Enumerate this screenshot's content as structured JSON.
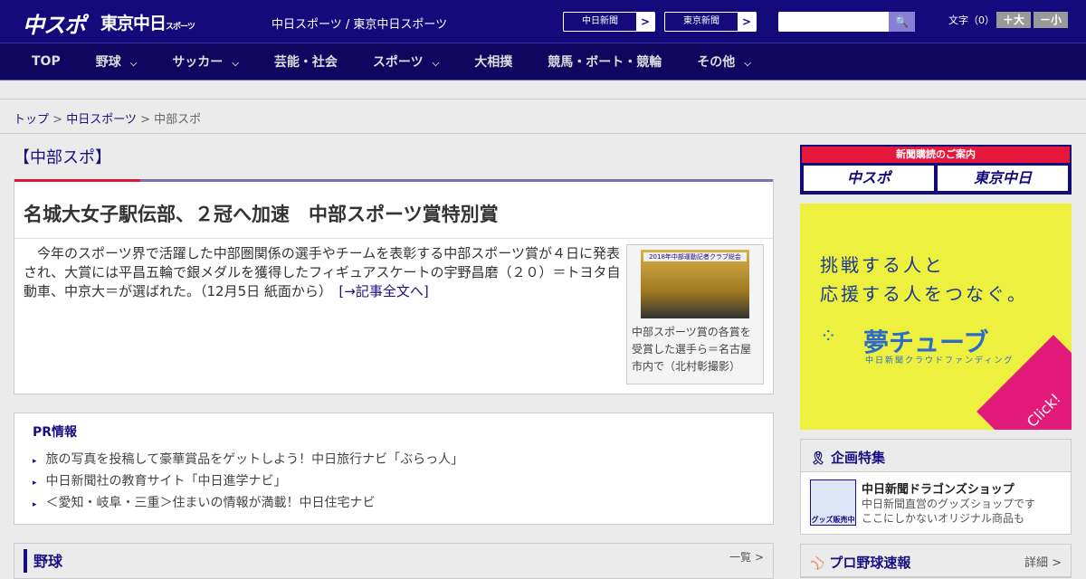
{
  "header": {
    "logo_chuspo": "中スポ",
    "logo_tokyo": "東京中日",
    "logo_tokyo_small": "スポーツ",
    "tagline": "中日スポーツ / 東京中日スポーツ",
    "links": [
      {
        "label": "中日新聞",
        "arrow": ">"
      },
      {
        "label": "東京新聞",
        "arrow": ">"
      }
    ],
    "search": {
      "placeholder": "",
      "icon": "search-icon",
      "glyph": "🔍"
    },
    "font_size_label": "文字（0）",
    "font_larger": "＋大",
    "font_smaller": "－小"
  },
  "nav": [
    {
      "label": "TOP"
    },
    {
      "label": "野球",
      "chev": "⌵"
    },
    {
      "label": "サッカー",
      "chev": "⌵"
    },
    {
      "label": "芸能・社会"
    },
    {
      "label": "スポーツ",
      "chev": "⌵"
    },
    {
      "label": "大相撲"
    },
    {
      "label": "競馬・ボート・競輪"
    },
    {
      "label": "その他",
      "chev": "⌵"
    }
  ],
  "breadcrumb": {
    "home": "トップ",
    "sep": " > ",
    "section": "中日スポーツ",
    "current": "中部スポ"
  },
  "section_title": "【中部スポ】",
  "article": {
    "title": "名城大女子駅伝部、２冠へ加速　中部スポーツ賞特別賞",
    "body": "今年のスポーツ界で活躍した中部圏関係の選手やチームを表彰する中部スポーツ賞が４日に発表され、大賞には平昌五輪で銀メダルを獲得したフィギュアスケートの宇野昌磨（２０）＝トヨタ自動車、中京大＝が選ばれた。（12月5日 紙面から）　",
    "more_link": "[→記事全文へ]",
    "photo_banner": "2018年中部運動記者クラブ総会",
    "photo_caption": "中部スポーツ賞の各賞を受賞した選手ら＝名古屋市内で（北村彰撮影）"
  },
  "pr": {
    "title": "PR情報",
    "items": [
      "旅の写真を投稿して豪華賞品をゲットしよう！中日旅行ナビ「ぶらっ人」",
      "中日新聞社の教育サイト「中日進学ナビ」",
      "＜愛知・岐阜・三重＞住まいの情報が満載！中日住宅ナビ"
    ]
  },
  "baseball": {
    "title": "野球",
    "more": "一覧 >"
  },
  "sidebar": {
    "subscribe": {
      "title": "新聞購読のご案内",
      "items": [
        "中スポ",
        "東京中日"
      ]
    },
    "ad": {
      "line1": "挑戦する人と",
      "line2": "応援する人をつなぐ。",
      "brand": "夢チューブ",
      "sub": "中日新聞クラウドファンディング",
      "cta": "Click!"
    },
    "feature": {
      "title": "企画特集",
      "icon_text": "グッズ販売中",
      "item_title": "中日新聞ドラゴンズショップ",
      "item_desc1": "中日新聞直営のグッズショップです",
      "item_desc2": "ここにしかないオリジナル商品も"
    },
    "pro": {
      "title": "プロ野球速報",
      "more": "詳細 >"
    }
  }
}
